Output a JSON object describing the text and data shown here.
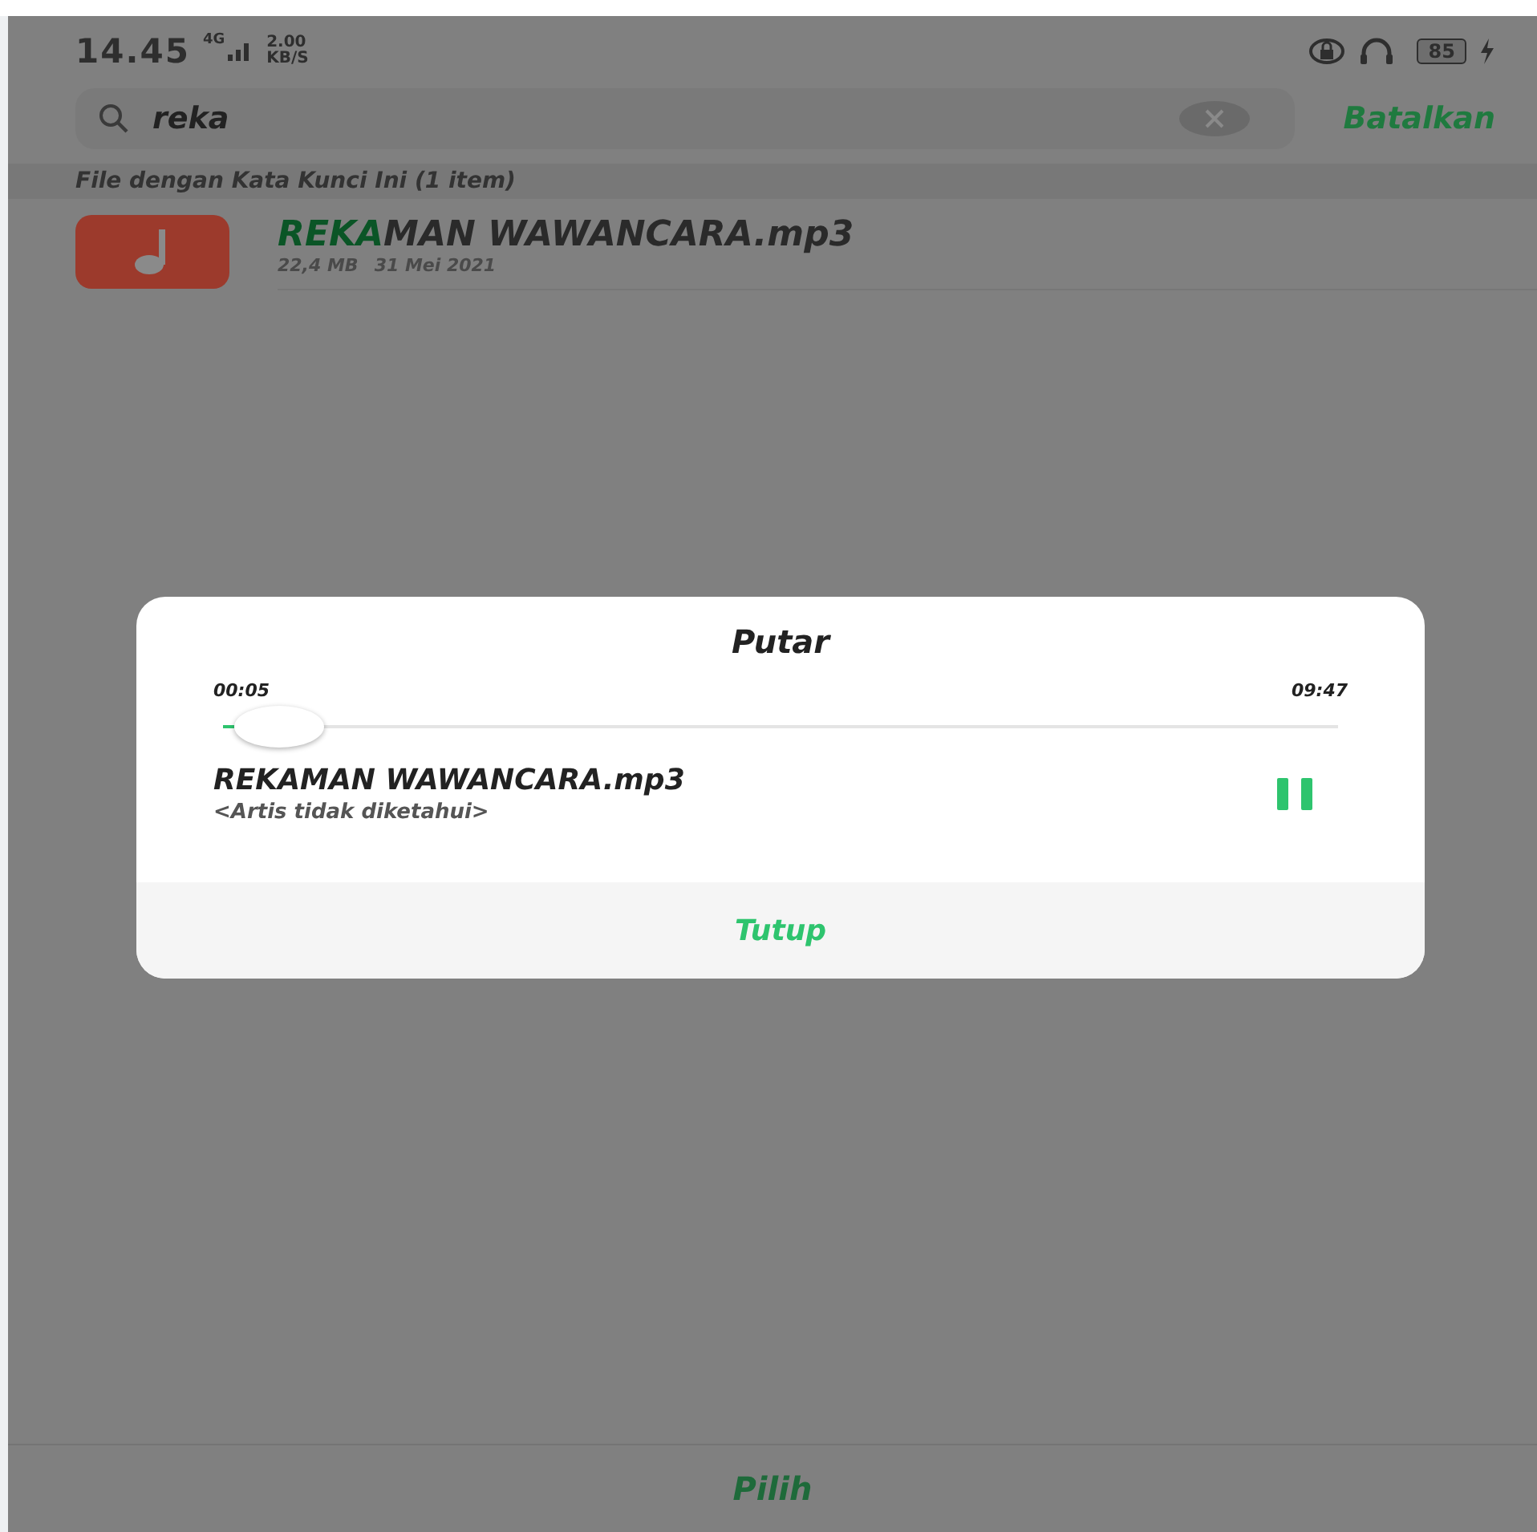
{
  "status_bar": {
    "time": "14.45",
    "network": "4G",
    "speed_value": "2.00",
    "speed_unit": "KB/S",
    "battery": "85"
  },
  "search": {
    "value": "reka",
    "cancel": "Batalkan"
  },
  "section_header": "File dengan Kata Kunci Ini (1 item)",
  "results": [
    {
      "title_parts": [
        {
          "text": "REKA",
          "highlight": true
        },
        {
          "text": "MAN WAWANCARA.mp3",
          "highlight": false
        }
      ],
      "size": "22,4 MB",
      "date": "31 Mei 2021"
    }
  ],
  "bottom_action": "Pilih",
  "dialog": {
    "title": "Putar",
    "elapsed": "00:05",
    "duration": "09:47",
    "level": 0.01,
    "track": "REKAMAN WAWANCARA.mp3",
    "artist": "<Artis tidak diketahui>",
    "playing": true,
    "close": "Tutup"
  }
}
